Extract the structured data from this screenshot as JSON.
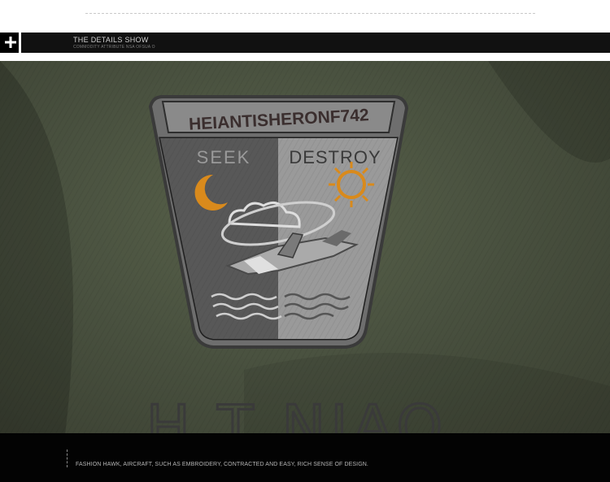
{
  "header": {
    "title": "THE DETAILS SHOW",
    "subtitle": "COMMODITY ATTRIBUTE NSA OFSUA O",
    "icon": "plus-icon"
  },
  "patch": {
    "top_text": "HEIANTISHERONF742",
    "left_word": "SEEK",
    "right_word": "DESTROY",
    "icons": [
      "moon-icon",
      "sun-icon",
      "cloud-icon",
      "aircraft-icon",
      "waves-icon"
    ],
    "colors": {
      "fabric": "#4a5240",
      "patch_border": "#2e2e2e",
      "emblem_orange": "#d98a1c"
    }
  },
  "brand_embroidery": "H.T NIAO",
  "footer": {
    "description": "FASHION HAWK, AIRCRAFT, SUCH AS EMBROIDERY, CONTRACTED AND EASY, RICH SENSE OF DESIGN."
  }
}
